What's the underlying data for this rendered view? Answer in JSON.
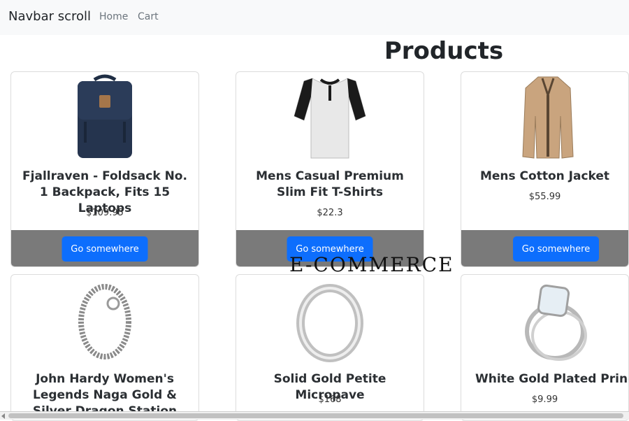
{
  "navbar": {
    "brand": "Navbar scroll",
    "links": [
      "Home",
      "Cart"
    ]
  },
  "page": {
    "title": "Products"
  },
  "products": [
    {
      "title": "Fjallraven - Foldsack No. 1 Backpack, Fits 15 Laptops",
      "price": "$109.95",
      "button": "Go somewhere",
      "icon": "backpack-image"
    },
    {
      "title": "Mens Casual Premium Slim Fit T-Shirts",
      "price": "$22.3",
      "button": "Go somewhere",
      "icon": "tshirt-image"
    },
    {
      "title": "Mens Cotton Jacket",
      "price": "$55.99",
      "button": "Go somewhere",
      "icon": "jacket-image"
    },
    {
      "title": "John Hardy Women's Legends Naga Gold & Silver Dragon Station Chain",
      "price": "",
      "button": "",
      "icon": "bracelet-image"
    },
    {
      "title": "Solid Gold Petite Micropave",
      "price": "$168",
      "button": "",
      "icon": "ring-image"
    },
    {
      "title": "White Gold Plated Princess",
      "price": "$9.99",
      "button": "",
      "icon": "rings-image"
    }
  ],
  "overlay": {
    "text": "E-COMMERCE"
  },
  "colors": {
    "navbar_bg": "#f8f9fa",
    "button": "#0d6efd",
    "card_footer": "#7a7a7a"
  }
}
